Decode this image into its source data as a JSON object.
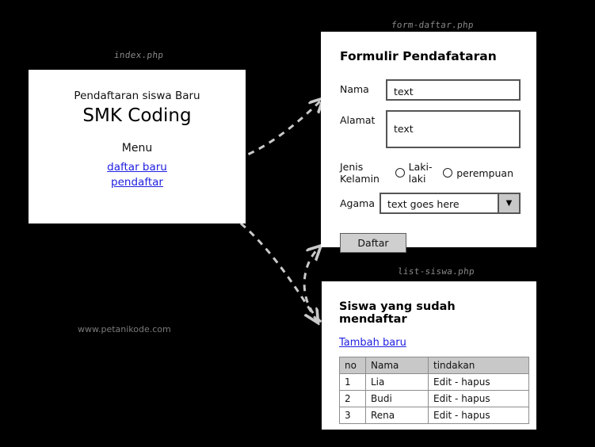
{
  "labels": {
    "index": "index.php",
    "form": "form-daftar.php",
    "list": "list-siswa.php"
  },
  "watermark": "www.petanikode.com",
  "colors": {
    "background": "#000000",
    "panel": "#ffffff",
    "label_text": "#8a8a8a",
    "link": "#2020e0",
    "arrow": "#c9c9c9",
    "control_fill": "#c8c8c8",
    "button_fill": "#cfcfcf",
    "border": "#555555"
  },
  "index_page": {
    "subtitle": "Pendaftaran siswa Baru",
    "title": "SMK Coding",
    "menu_heading": "Menu",
    "links": [
      {
        "label": "daftar baru"
      },
      {
        "label": "pendaftar"
      }
    ]
  },
  "form_page": {
    "title": "Formulir Pendafataran",
    "fields": [
      {
        "label": "Nama",
        "value": "text",
        "type": "text"
      },
      {
        "label": "Alamat",
        "value": "text",
        "type": "textarea"
      }
    ],
    "gender": {
      "label": "Jenis Kelamin",
      "options": [
        {
          "label": "Laki-laki",
          "selected": false
        },
        {
          "label": "perempuan",
          "selected": false
        }
      ]
    },
    "religion": {
      "label": "Agama",
      "value": "text goes here",
      "arrow_glyph": "▼"
    },
    "submit_label": "Daftar"
  },
  "list_page": {
    "title": "Siswa yang sudah mendaftar",
    "add_link": "Tambah baru",
    "table": {
      "headers": [
        "no",
        "Nama",
        "tindakan"
      ],
      "rows": [
        [
          "1",
          "Lia",
          "Edit - hapus"
        ],
        [
          "2",
          "Budi",
          "Edit - hapus"
        ],
        [
          "3",
          "Rena",
          "Edit - hapus"
        ]
      ]
    }
  },
  "connectors": [
    {
      "from": "daftar baru",
      "to": "form-daftar.php"
    },
    {
      "from": "pendaftar",
      "to": "list-siswa.php"
    },
    {
      "from": "Tambah baru",
      "to": "form-daftar.php"
    }
  ]
}
